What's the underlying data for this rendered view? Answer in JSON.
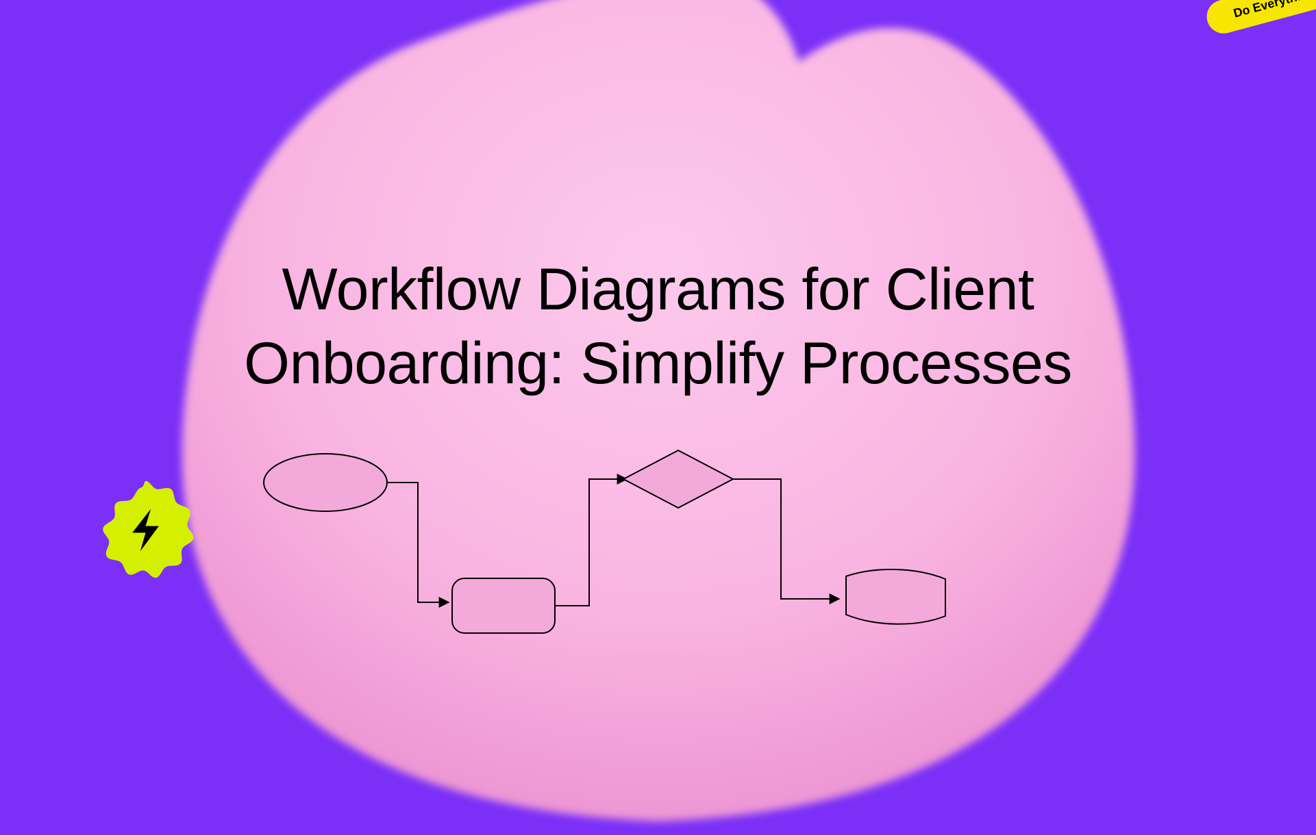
{
  "title": "Workflow Diagrams for Client Onboarding: Simplify Processes",
  "tag": "Do Everything",
  "colors": {
    "background": "#7B2FF7",
    "blob": "#F9B4E1",
    "blob_shadow": "#E989CE",
    "accent_lime": "#D4F000",
    "accent_yellow": "#F7E600",
    "shape_fill": "#F3A9D9",
    "shape_stroke": "#000000"
  },
  "flowchart": {
    "nodes": [
      {
        "id": "start",
        "type": "terminator"
      },
      {
        "id": "process",
        "type": "process"
      },
      {
        "id": "decision",
        "type": "decision"
      },
      {
        "id": "document",
        "type": "document"
      }
    ],
    "edges": [
      {
        "from": "start",
        "to": "process"
      },
      {
        "from": "process",
        "to": "decision"
      },
      {
        "from": "decision",
        "to": "document"
      }
    ]
  }
}
